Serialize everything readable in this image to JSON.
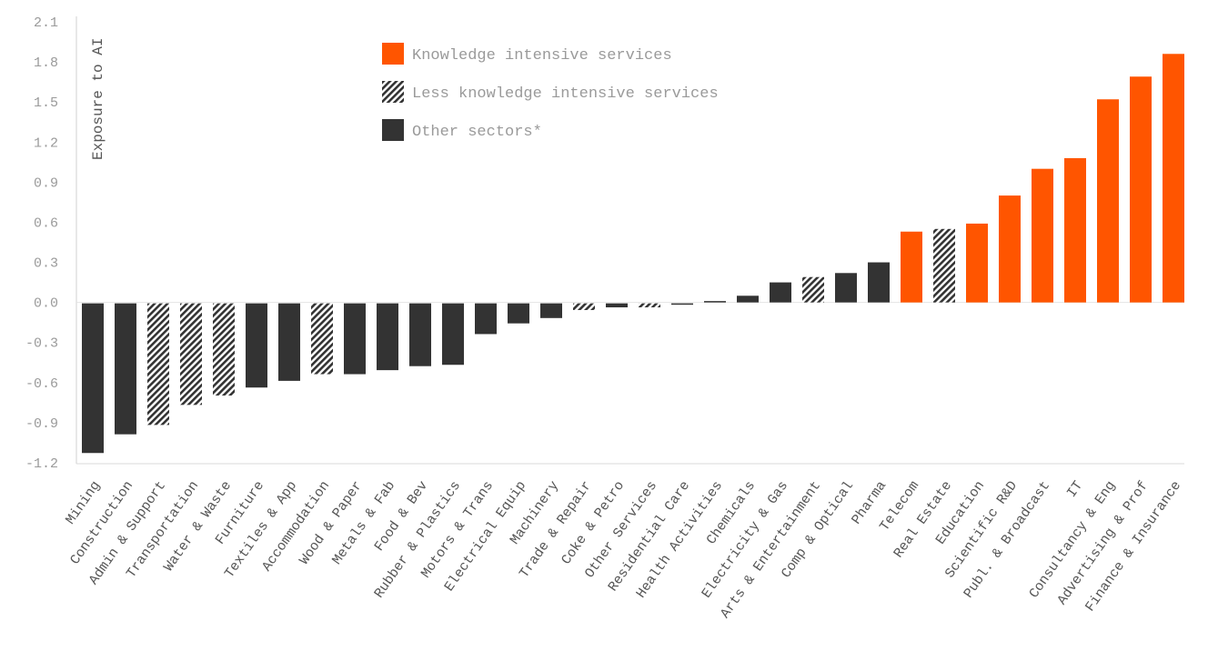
{
  "chart_data": {
    "type": "bar",
    "title": "",
    "xlabel": "",
    "ylabel": "Exposure to AI",
    "ylim": [
      -1.2,
      2.1
    ],
    "yticks": [
      "2.1",
      "1.8",
      "1.5",
      "1.2",
      "0.9",
      "0.6",
      "0.3",
      "0.0",
      "-0.3",
      "-0.6",
      "-0.9",
      "-1.2"
    ],
    "grid": false,
    "legend_position": "top-center",
    "legend": [
      {
        "key": "knowledge",
        "label": "Knowledge intensive services",
        "color": "#FF5500",
        "pattern": "solid"
      },
      {
        "key": "less",
        "label": "Less knowledge intensive services",
        "color": "#333333",
        "pattern": "hatched"
      },
      {
        "key": "other",
        "label": "Other sectors*",
        "color": "#333333",
        "pattern": "solid"
      }
    ],
    "categories": [
      "Mining",
      "Construction",
      "Admin & Support",
      "Transportation",
      "Water & Waste",
      "Furniture",
      "Textiles & App",
      "Accommodation",
      "Wood & Paper",
      "Metals & Fab",
      "Food & Bev",
      "Rubber & Plastics",
      "Motors & Trans",
      "Electrical Equip",
      "Machinery",
      "Trade & Repair",
      "Coke & Petro",
      "Other Services",
      "Residential Care",
      "Health Activities",
      "Chemicals",
      "Electricity & Gas",
      "Arts & Entertainment",
      "Comp & Optical",
      "Pharma",
      "Telecom",
      "Real Estate",
      "Education",
      "Scientific R&D",
      "Publ. & Broadcast",
      "IT",
      "Consultancy & Eng",
      "Advertising & Prof",
      "Finance & Insurance"
    ],
    "values": [
      -1.12,
      -0.98,
      -0.91,
      -0.76,
      -0.69,
      -0.63,
      -0.58,
      -0.53,
      -0.53,
      -0.5,
      -0.47,
      -0.46,
      -0.23,
      -0.15,
      -0.11,
      -0.05,
      -0.03,
      -0.03,
      -0.01,
      0.01,
      0.05,
      0.15,
      0.19,
      0.22,
      0.3,
      0.53,
      0.55,
      0.59,
      0.8,
      1.0,
      1.08,
      1.52,
      1.69,
      1.86
    ],
    "groups": [
      "other",
      "other",
      "less",
      "less",
      "less",
      "other",
      "other",
      "less",
      "other",
      "other",
      "other",
      "other",
      "other",
      "other",
      "other",
      "less",
      "other",
      "less",
      "other",
      "other",
      "other",
      "other",
      "less",
      "other",
      "other",
      "knowledge",
      "less",
      "knowledge",
      "knowledge",
      "knowledge",
      "knowledge",
      "knowledge",
      "knowledge",
      "knowledge"
    ]
  }
}
